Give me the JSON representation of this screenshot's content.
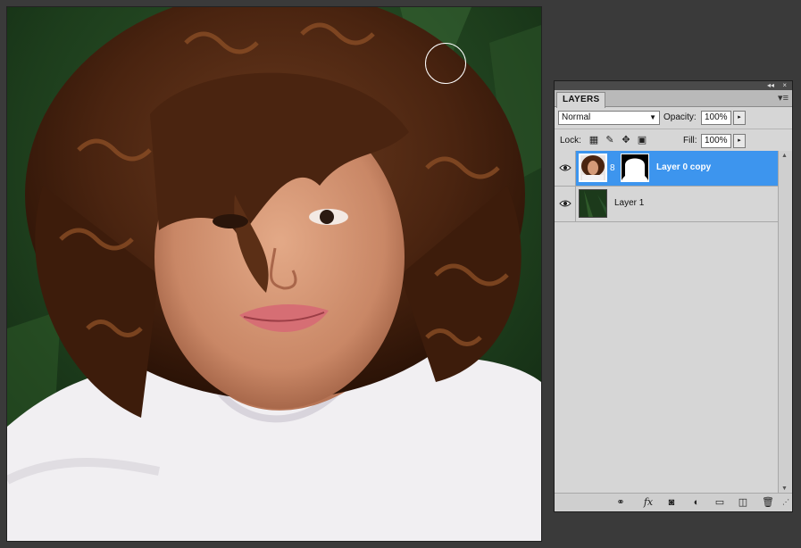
{
  "panel": {
    "tab_label": "LAYERS",
    "blend_mode": "Normal",
    "opacity_label": "Opacity:",
    "opacity_value": "100%",
    "lock_label": "Lock:",
    "fill_label": "Fill:",
    "fill_value": "100%",
    "lock_icons": [
      "lock-transparent-pixels-icon",
      "lock-image-pixels-icon",
      "lock-position-icon",
      "lock-all-icon"
    ],
    "layers": [
      {
        "name": "Layer 0 copy",
        "selected": true,
        "visible": true,
        "has_mask": true
      },
      {
        "name": "Layer 1",
        "selected": false,
        "visible": true,
        "has_mask": false
      }
    ],
    "bottom_icons": [
      "link-layers-icon",
      "layer-style-fx-icon",
      "add-mask-icon",
      "adjustment-layer-icon",
      "new-group-icon",
      "new-layer-icon",
      "delete-layer-icon"
    ]
  },
  "colors": {
    "selection": "#3d95ee",
    "panel_bg": "#d6d6d6",
    "workspace_bg": "#3a3a3a"
  }
}
